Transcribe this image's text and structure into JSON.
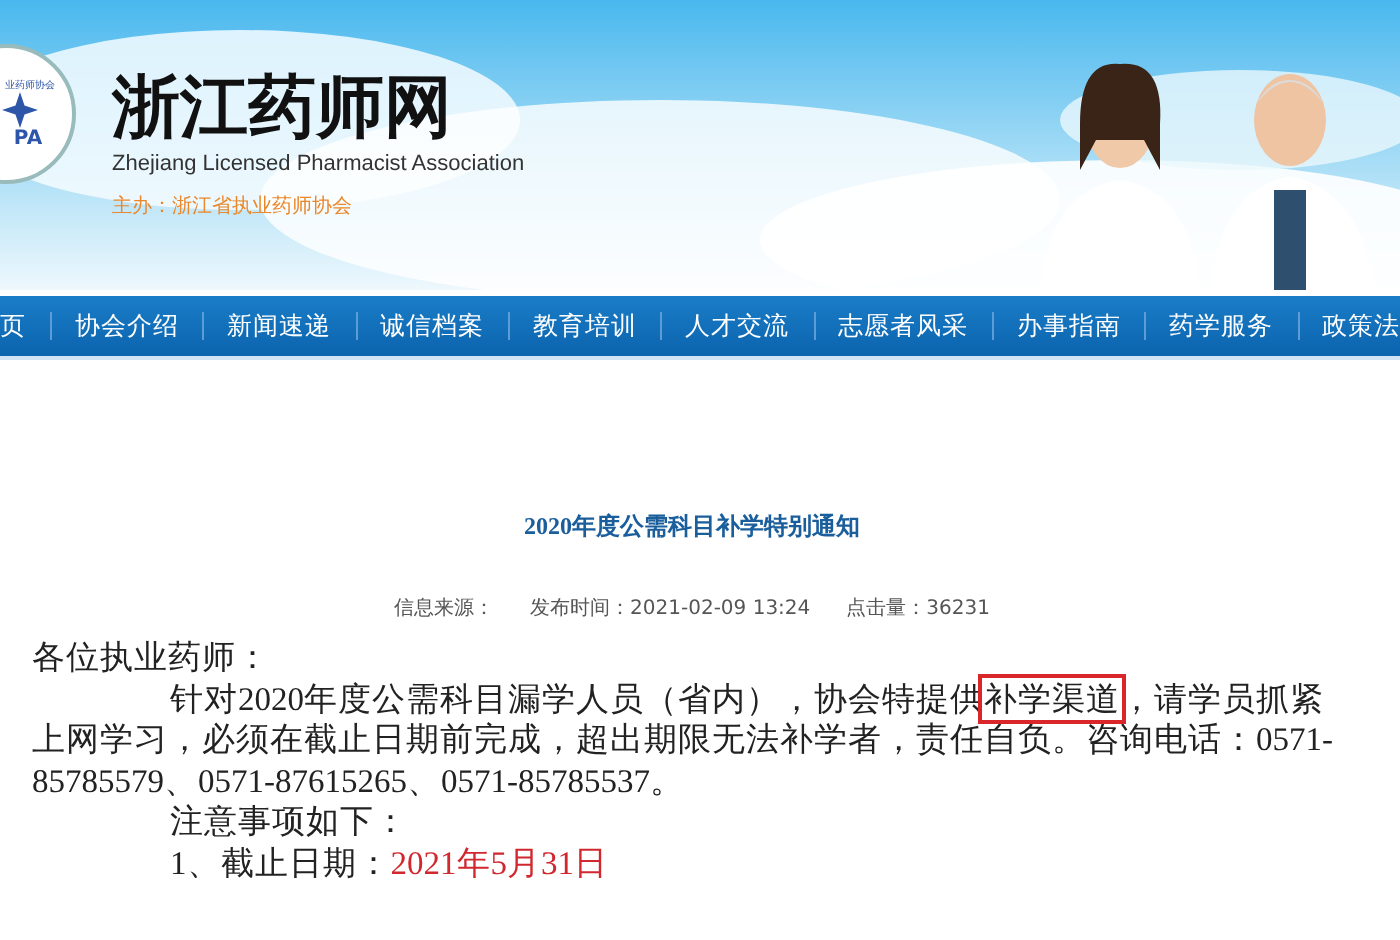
{
  "header": {
    "logo": {
      "ring_text": "业药师协会",
      "initials": "PA"
    },
    "site_title": "浙江药师网",
    "subtitle": "Zhejiang Licensed Pharmacist Association",
    "sponsor": "主办：浙江省执业药师协会"
  },
  "nav": [
    {
      "label": "页"
    },
    {
      "label": "协会介绍"
    },
    {
      "label": "新闻速递"
    },
    {
      "label": "诚信档案"
    },
    {
      "label": "教育培训"
    },
    {
      "label": "人才交流"
    },
    {
      "label": "志愿者风采"
    },
    {
      "label": "办事指南"
    },
    {
      "label": "药学服务"
    },
    {
      "label": "政策法"
    }
  ],
  "article": {
    "title": "2020年度公需科目补学特别通知",
    "meta": [
      {
        "label": "信息来源："
      },
      {
        "label": "发布时间：",
        "value": "2021-02-09 13:24"
      },
      {
        "label": "点击量：",
        "value": "36231"
      }
    ],
    "greeting": "各位执业药师：",
    "paragraph": {
      "before": "针对2020年度公需科目漏学人员（省内），协会特提供",
      "highlighted": "补学渠道",
      "after": "，请学员抓紧上网学习，必须在截止日期前完成，超出期限无法补学者，责任自负。咨询电话：0571-85785579、0571-87615265、0571-85785537。"
    },
    "notes_heading": "注意事项如下：",
    "items": [
      {
        "label": "1、截止日期：",
        "value": "2021年5月31日"
      }
    ]
  }
}
